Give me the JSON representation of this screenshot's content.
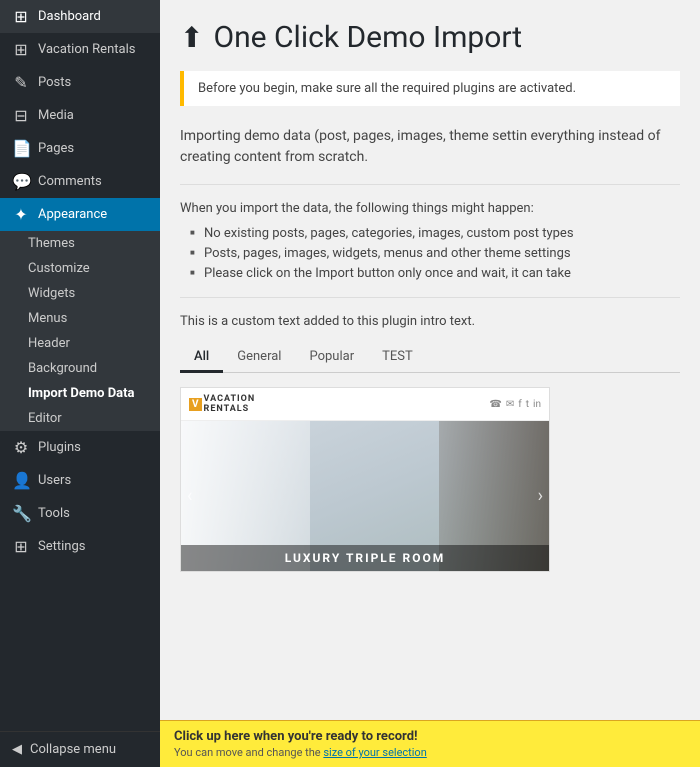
{
  "sidebar": {
    "items": [
      {
        "label": "Dashboard",
        "icon": "⊞",
        "id": "dashboard"
      },
      {
        "label": "Vacation Rentals",
        "icon": "⊞",
        "id": "vacation-rentals"
      },
      {
        "label": "Posts",
        "icon": "📄",
        "id": "posts"
      },
      {
        "label": "Media",
        "icon": "🖼",
        "id": "media"
      },
      {
        "label": "Pages",
        "icon": "📋",
        "id": "pages"
      },
      {
        "label": "Comments",
        "icon": "💬",
        "id": "comments"
      },
      {
        "label": "Appearance",
        "icon": "🎨",
        "id": "appearance"
      },
      {
        "label": "Plugins",
        "icon": "🔌",
        "id": "plugins"
      },
      {
        "label": "Users",
        "icon": "👤",
        "id": "users"
      },
      {
        "label": "Tools",
        "icon": "🔧",
        "id": "tools"
      },
      {
        "label": "Settings",
        "icon": "⚙",
        "id": "settings"
      }
    ],
    "appearance_sub": [
      {
        "label": "Themes",
        "id": "themes"
      },
      {
        "label": "Customize",
        "id": "customize"
      },
      {
        "label": "Widgets",
        "id": "widgets"
      },
      {
        "label": "Menus",
        "id": "menus"
      },
      {
        "label": "Header",
        "id": "header"
      },
      {
        "label": "Background",
        "id": "background"
      },
      {
        "label": "Import Demo Data",
        "id": "import-demo",
        "active": true
      },
      {
        "label": "Editor",
        "id": "editor"
      }
    ],
    "collapse_label": "Collapse menu"
  },
  "main": {
    "title": "One Click Demo Import",
    "title_icon": "⬆",
    "notice": "Before you begin, make sure all the required plugins are activated.",
    "intro": "Importing demo data (post, pages, images, theme settin everything instead of creating content from scratch.",
    "when_import": "When you import the data, the following things might happen:",
    "bullets": [
      "No existing posts, pages, categories, images, custom post types",
      "Posts, pages, images, widgets, menus and other theme settings",
      "Please click on the Import button only once and wait, it can take"
    ],
    "custom_text": "This is a custom text added to this plugin intro text.",
    "tabs": [
      {
        "label": "All",
        "active": true
      },
      {
        "label": "General"
      },
      {
        "label": "Popular"
      },
      {
        "label": "TEST"
      }
    ],
    "demo_preview": {
      "brand": "VACATION",
      "brand_sub": "RENTALS",
      "room_label": "LUXURY TRIPLE ROOM"
    }
  },
  "bottom_bar": {
    "title": "Click up here when you're ready to record!",
    "subtitle": "You can move and change the size of your selection"
  }
}
